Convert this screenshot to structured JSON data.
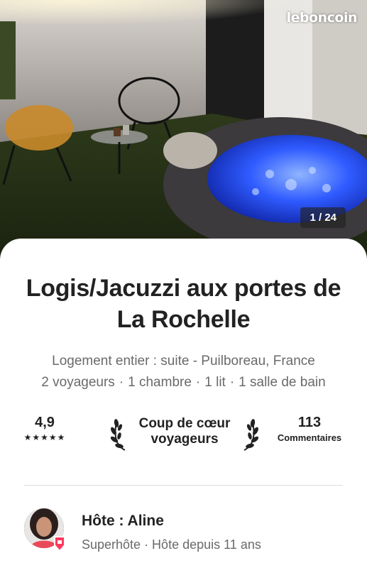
{
  "photo": {
    "watermark": "leboncoin",
    "counter": "1 / 24"
  },
  "listing": {
    "title": "Logis/Jacuzzi aux portes de La Rochelle",
    "type_location": "Logement entier : suite - Puilboreau, France",
    "details": [
      "2 voyageurs",
      "1 chambre",
      "1 lit",
      "1 salle de bain"
    ],
    "separator": "·"
  },
  "stats": {
    "rating": "4,9",
    "stars": "★★★★★",
    "rating_stars": 5,
    "favorite_line1": "Coup de cœur",
    "favorite_line2": "voyageurs",
    "reviews_count": "113",
    "reviews_label": "Commentaires"
  },
  "host": {
    "title": "Hôte : Aline",
    "meta": "Superhôte · Hôte depuis 11 ans"
  },
  "colors": {
    "text": "#222222",
    "muted": "#6a6a6a",
    "divider": "#dddddd",
    "badge": "#ff385c",
    "jacuzzi_water": "#2a55ff"
  },
  "icons": {
    "laurel": "laurel-icon",
    "superhost": "superhost-badge-icon"
  }
}
